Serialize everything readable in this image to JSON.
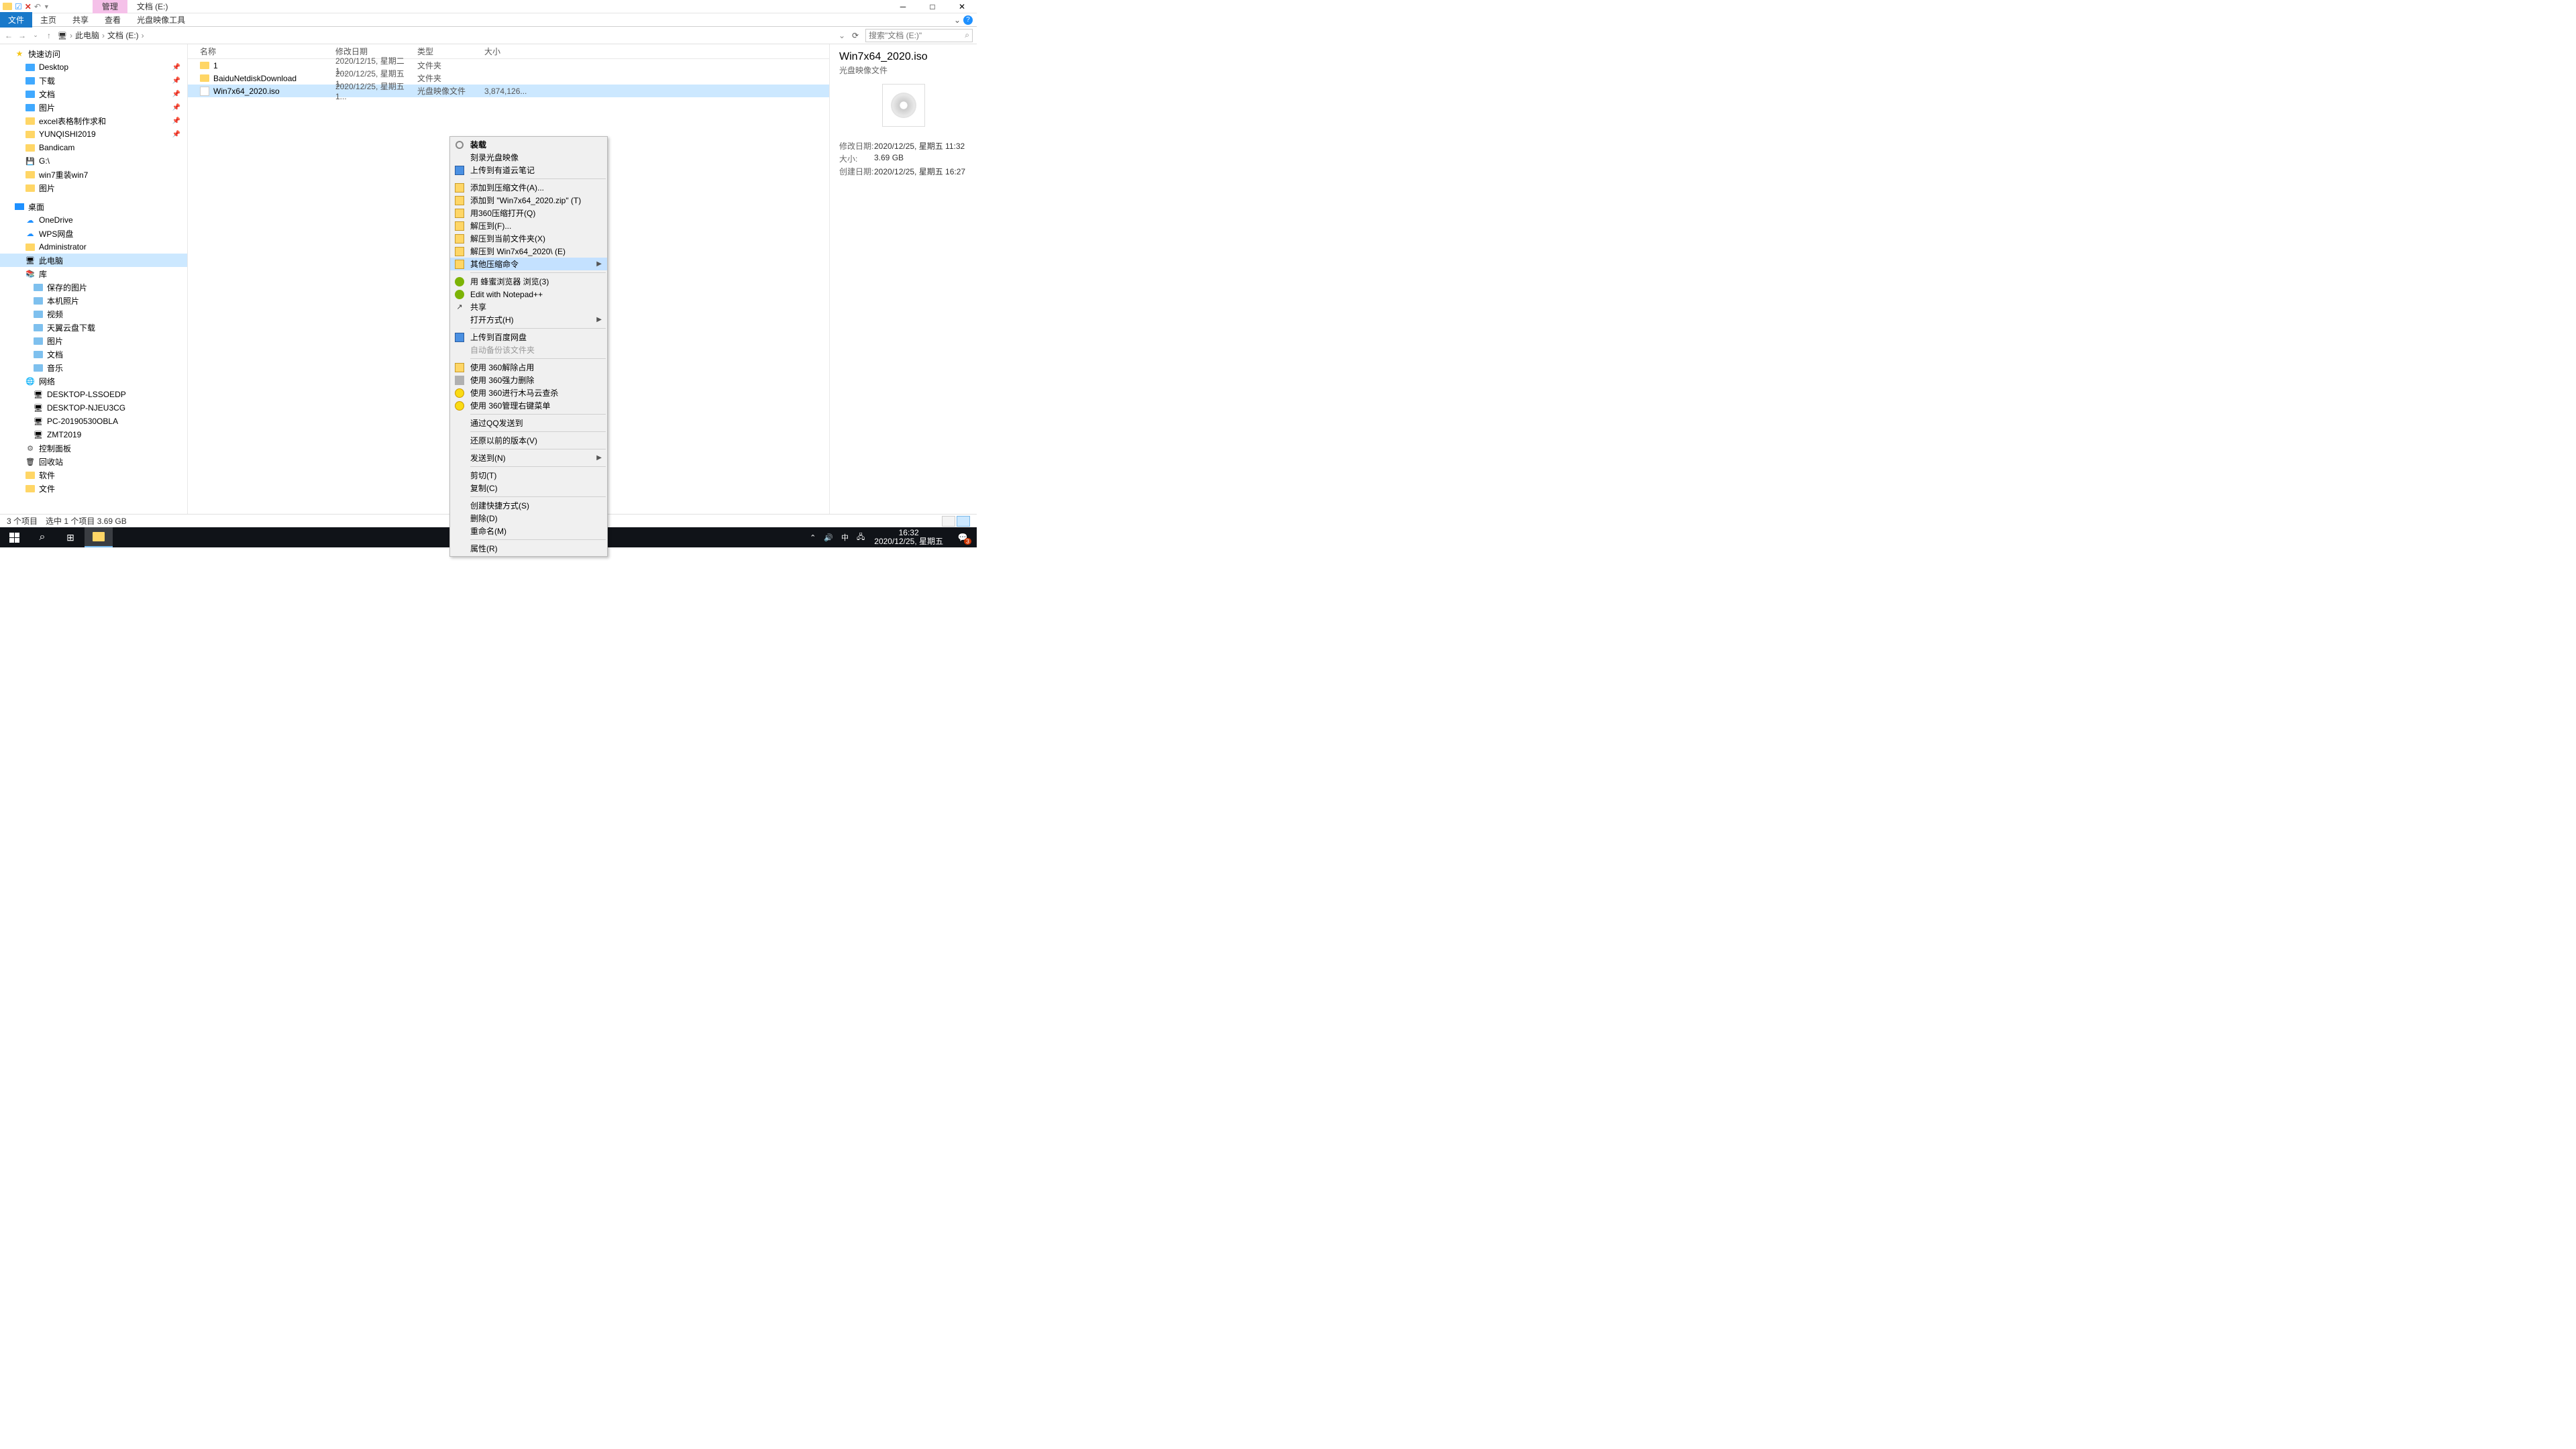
{
  "titlebar": {
    "contextual_tab": "管理",
    "window_title": "文档 (E:)"
  },
  "ribbon": {
    "tabs": [
      "文件",
      "主页",
      "共享",
      "查看",
      "光盘映像工具"
    ],
    "active": 0
  },
  "address": {
    "crumbs": [
      "此电脑",
      "文档 (E:)"
    ],
    "search_placeholder": "搜索\"文档 (E:)\""
  },
  "nav": {
    "quick_access": {
      "label": "快速访问"
    },
    "items_top": [
      {
        "label": "Desktop",
        "pinned": true,
        "icon": "blue"
      },
      {
        "label": "下载",
        "pinned": true,
        "icon": "blue"
      },
      {
        "label": "文档",
        "pinned": true,
        "icon": "blue"
      },
      {
        "label": "图片",
        "pinned": true,
        "icon": "blue"
      },
      {
        "label": "excel表格制作求和",
        "pinned": true,
        "icon": "yellow"
      },
      {
        "label": "YUNQISHI2019",
        "pinned": true,
        "icon": "yellow"
      },
      {
        "label": "Bandicam",
        "icon": "yellow"
      },
      {
        "label": "G:\\",
        "icon": "drive"
      },
      {
        "label": "win7重装win7",
        "icon": "yellow"
      },
      {
        "label": "图片",
        "icon": "yellow"
      }
    ],
    "desktop": {
      "label": "桌面"
    },
    "items_mid": [
      {
        "label": "OneDrive",
        "icon": "cloud"
      },
      {
        "label": "WPS网盘",
        "icon": "cloud"
      },
      {
        "label": "Administrator",
        "icon": "yellow"
      },
      {
        "label": "此电脑",
        "icon": "pc",
        "selected": true
      },
      {
        "label": "库",
        "icon": "lib"
      }
    ],
    "lib_items": [
      {
        "label": "保存的图片"
      },
      {
        "label": "本机照片"
      },
      {
        "label": "视频"
      },
      {
        "label": "天翼云盘下载"
      },
      {
        "label": "图片"
      },
      {
        "label": "文档"
      },
      {
        "label": "音乐"
      }
    ],
    "network": {
      "label": "网络"
    },
    "net_items": [
      {
        "label": "DESKTOP-LSSOEDP"
      },
      {
        "label": "DESKTOP-NJEU3CG"
      },
      {
        "label": "PC-20190530OBLA"
      },
      {
        "label": "ZMT2019"
      }
    ],
    "bottom": [
      {
        "label": "控制面板",
        "icon": "cp"
      },
      {
        "label": "回收站",
        "icon": "recycle"
      },
      {
        "label": "软件",
        "icon": "yellow"
      },
      {
        "label": "文件",
        "icon": "yellow"
      }
    ]
  },
  "list": {
    "headers": {
      "name": "名称",
      "date": "修改日期",
      "type": "类型",
      "size": "大小"
    },
    "rows": [
      {
        "name": "1",
        "date": "2020/12/15, 星期二 1...",
        "type": "文件夹",
        "size": "",
        "kind": "folder"
      },
      {
        "name": "BaiduNetdiskDownload",
        "date": "2020/12/25, 星期五 1...",
        "type": "文件夹",
        "size": "",
        "kind": "folder"
      },
      {
        "name": "Win7x64_2020.iso",
        "date": "2020/12/25, 星期五 1...",
        "type": "光盘映像文件",
        "size": "3,874,126...",
        "kind": "iso",
        "selected": true
      }
    ]
  },
  "context_menu": {
    "hover_index": 9,
    "groups": [
      [
        {
          "label": "装载",
          "bold": true,
          "icon": "disc"
        },
        {
          "label": "刻录光盘映像",
          "icon": ""
        },
        {
          "label": "上传到有道云笔记",
          "icon": "blue"
        }
      ],
      [
        {
          "label": "添加到压缩文件(A)...",
          "icon": "box"
        },
        {
          "label": "添加到 \"Win7x64_2020.zip\" (T)",
          "icon": "box"
        },
        {
          "label": "用360压缩打开(Q)",
          "icon": "box"
        },
        {
          "label": "解压到(F)...",
          "icon": "box"
        },
        {
          "label": "解压到当前文件夹(X)",
          "icon": "box"
        },
        {
          "label": "解压到 Win7x64_2020\\ (E)",
          "icon": "box"
        },
        {
          "label": "其他压缩命令",
          "icon": "box",
          "submenu": true
        }
      ],
      [
        {
          "label": "用 蜂蜜浏览器 浏览(3)",
          "icon": "green"
        },
        {
          "label": "Edit with Notepad++",
          "icon": "green"
        },
        {
          "label": "共享",
          "icon": "share"
        },
        {
          "label": "打开方式(H)",
          "submenu": true
        }
      ],
      [
        {
          "label": "上传到百度网盘",
          "icon": "blue"
        },
        {
          "label": "自动备份该文件夹",
          "disabled": true
        }
      ],
      [
        {
          "label": "使用 360解除占用",
          "icon": "box"
        },
        {
          "label": "使用 360强力删除",
          "icon": "trash"
        },
        {
          "label": "使用 360进行木马云查杀",
          "icon": "yellow"
        },
        {
          "label": "使用 360管理右键菜单",
          "icon": "yellow"
        }
      ],
      [
        {
          "label": "通过QQ发送到"
        }
      ],
      [
        {
          "label": "还原以前的版本(V)"
        }
      ],
      [
        {
          "label": "发送到(N)",
          "submenu": true
        }
      ],
      [
        {
          "label": "剪切(T)"
        },
        {
          "label": "复制(C)"
        }
      ],
      [
        {
          "label": "创建快捷方式(S)"
        },
        {
          "label": "删除(D)"
        },
        {
          "label": "重命名(M)"
        }
      ],
      [
        {
          "label": "属性(R)"
        }
      ]
    ]
  },
  "details": {
    "title": "Win7x64_2020.iso",
    "subtitle": "光盘映像文件",
    "rows": [
      {
        "label": "修改日期:",
        "value": "2020/12/25, 星期五 11:32"
      },
      {
        "label": "大小:",
        "value": "3.69 GB"
      },
      {
        "label": "创建日期:",
        "value": "2020/12/25, 星期五 16:27"
      }
    ]
  },
  "status": {
    "count": "3 个项目",
    "selection": "选中 1 个项目  3.69 GB"
  },
  "taskbar": {
    "time": "16:32",
    "date": "2020/12/25, 星期五",
    "ime": "中",
    "notif_count": "3"
  }
}
